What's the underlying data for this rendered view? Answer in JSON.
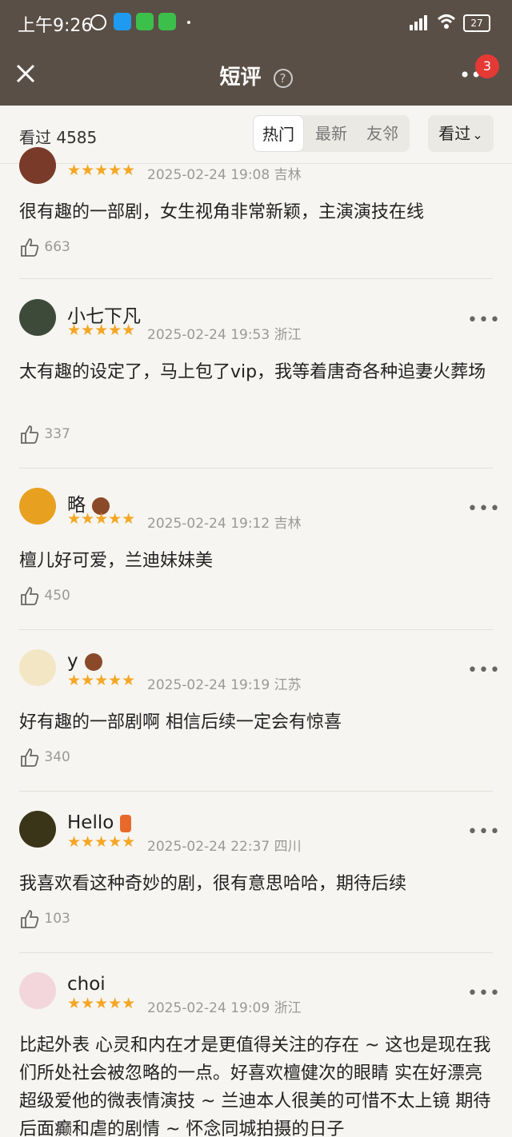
{
  "status_bar": {
    "time": "上午9:26",
    "battery": "27"
  },
  "header": {
    "title": "短评",
    "help_icon": "question-circle-icon",
    "close_icon": "close-icon",
    "more_icon": "more-dots-icon",
    "notification_count": "3"
  },
  "filters": {
    "seen_count": "看过 4585",
    "tabs": [
      "热门",
      "最新",
      "友邻"
    ],
    "active_tab": "热门",
    "seen_dropdown": "看过"
  },
  "reviews": [
    {
      "user": "",
      "stars": "★★★★★",
      "meta": "2025-02-24 19:08 吉林",
      "text": "很有趣的一部剧，女生视角非常新颖，主演演技在线",
      "likes": "663"
    },
    {
      "user": "小七下凡",
      "stars": "★★★★★",
      "meta": "2025-02-24 19:53 浙江",
      "text": "太有趣的设定了，马上包了vip，我等着唐奇各种追妻火葬场",
      "likes": "337"
    },
    {
      "user": "略",
      "stars": "★★★★★",
      "meta": "2025-02-24 19:12 吉林",
      "text": "檀儿好可爱，兰迪妹妹美",
      "likes": "450"
    },
    {
      "user": "y",
      "stars": "★★★★★",
      "meta": "2025-02-24 19:19 江苏",
      "text": "好有趣的一部剧啊 相信后续一定会有惊喜",
      "likes": "340"
    },
    {
      "user": "Hello",
      "stars": "★★★★★",
      "meta": "2025-02-24 22:37 四川",
      "text": "我喜欢看这种奇妙的剧，很有意思哈哈，期待后续",
      "likes": "103"
    },
    {
      "user": "choi",
      "stars": "★★★★★",
      "meta": "2025-02-24 19:09 浙江",
      "text": "比起外表 心灵和内在才是更值得关注的存在 ~ 这也是现在我们所处社会被忽略的一点。好喜欢檀健次的眼睛 实在好漂亮 超级爱他的微表情演技 ~ 兰迪本人很美的可惜不太上镜 期待后面癫和虐的剧情 ~ 怀念同城拍摄的日子",
      "likes": ""
    }
  ],
  "more_label": "•••"
}
